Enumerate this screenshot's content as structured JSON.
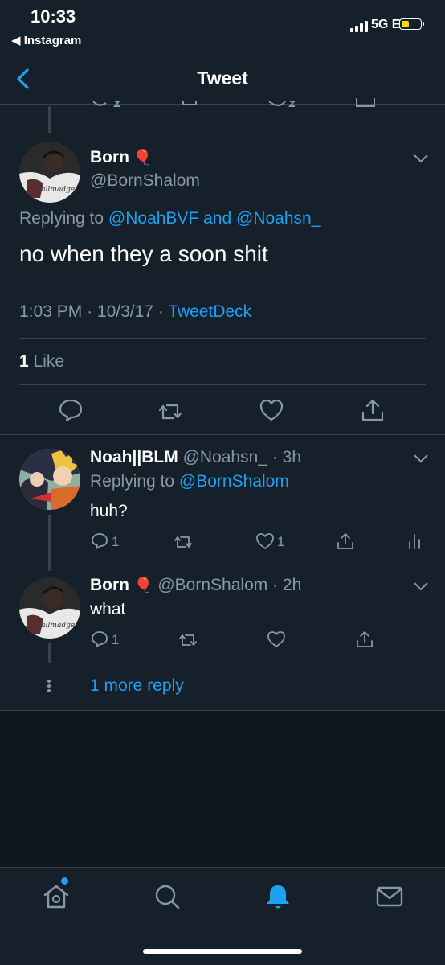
{
  "status_bar": {
    "time": "10:33",
    "back_app": "◀ Instagram",
    "network": "5G E",
    "battery_level": 0.45,
    "battery_color": "#ffd60a"
  },
  "nav": {
    "title": "Tweet"
  },
  "main_tweet": {
    "author_name": "Born",
    "emoji": "🎈",
    "handle": "@BornShalom",
    "replying_prefix": "Replying to",
    "replying_user1": "@NoahBVF",
    "replying_and": "and",
    "replying_user2": "@Noahsn_",
    "text": "no when they a soon shit",
    "time": "1:03 PM",
    "date": "10/3/17",
    "source": "TweetDeck",
    "likes_count": "1",
    "likes_label": "Like"
  },
  "reply1": {
    "author_name": "Noah||BLM",
    "handle": "@Noahsn_",
    "age": "3h",
    "replying_prefix": "Replying to",
    "replying_user": "@BornShalom",
    "text": "huh?",
    "reply_count": "1",
    "like_count": "1"
  },
  "reply2": {
    "author_name": "Born",
    "emoji": "🎈",
    "handle": "@BornShalom",
    "age": "2h",
    "text": "what",
    "reply_count": "1"
  },
  "more_replies": "1 more reply",
  "colors": {
    "background": "#15202b",
    "accent": "#1da1f2",
    "muted": "#8899a6",
    "divider": "#38444d"
  },
  "tab_bar": {
    "items": [
      "home-icon",
      "search-icon",
      "notifications-icon",
      "messages-icon"
    ],
    "active": "notifications-icon"
  }
}
